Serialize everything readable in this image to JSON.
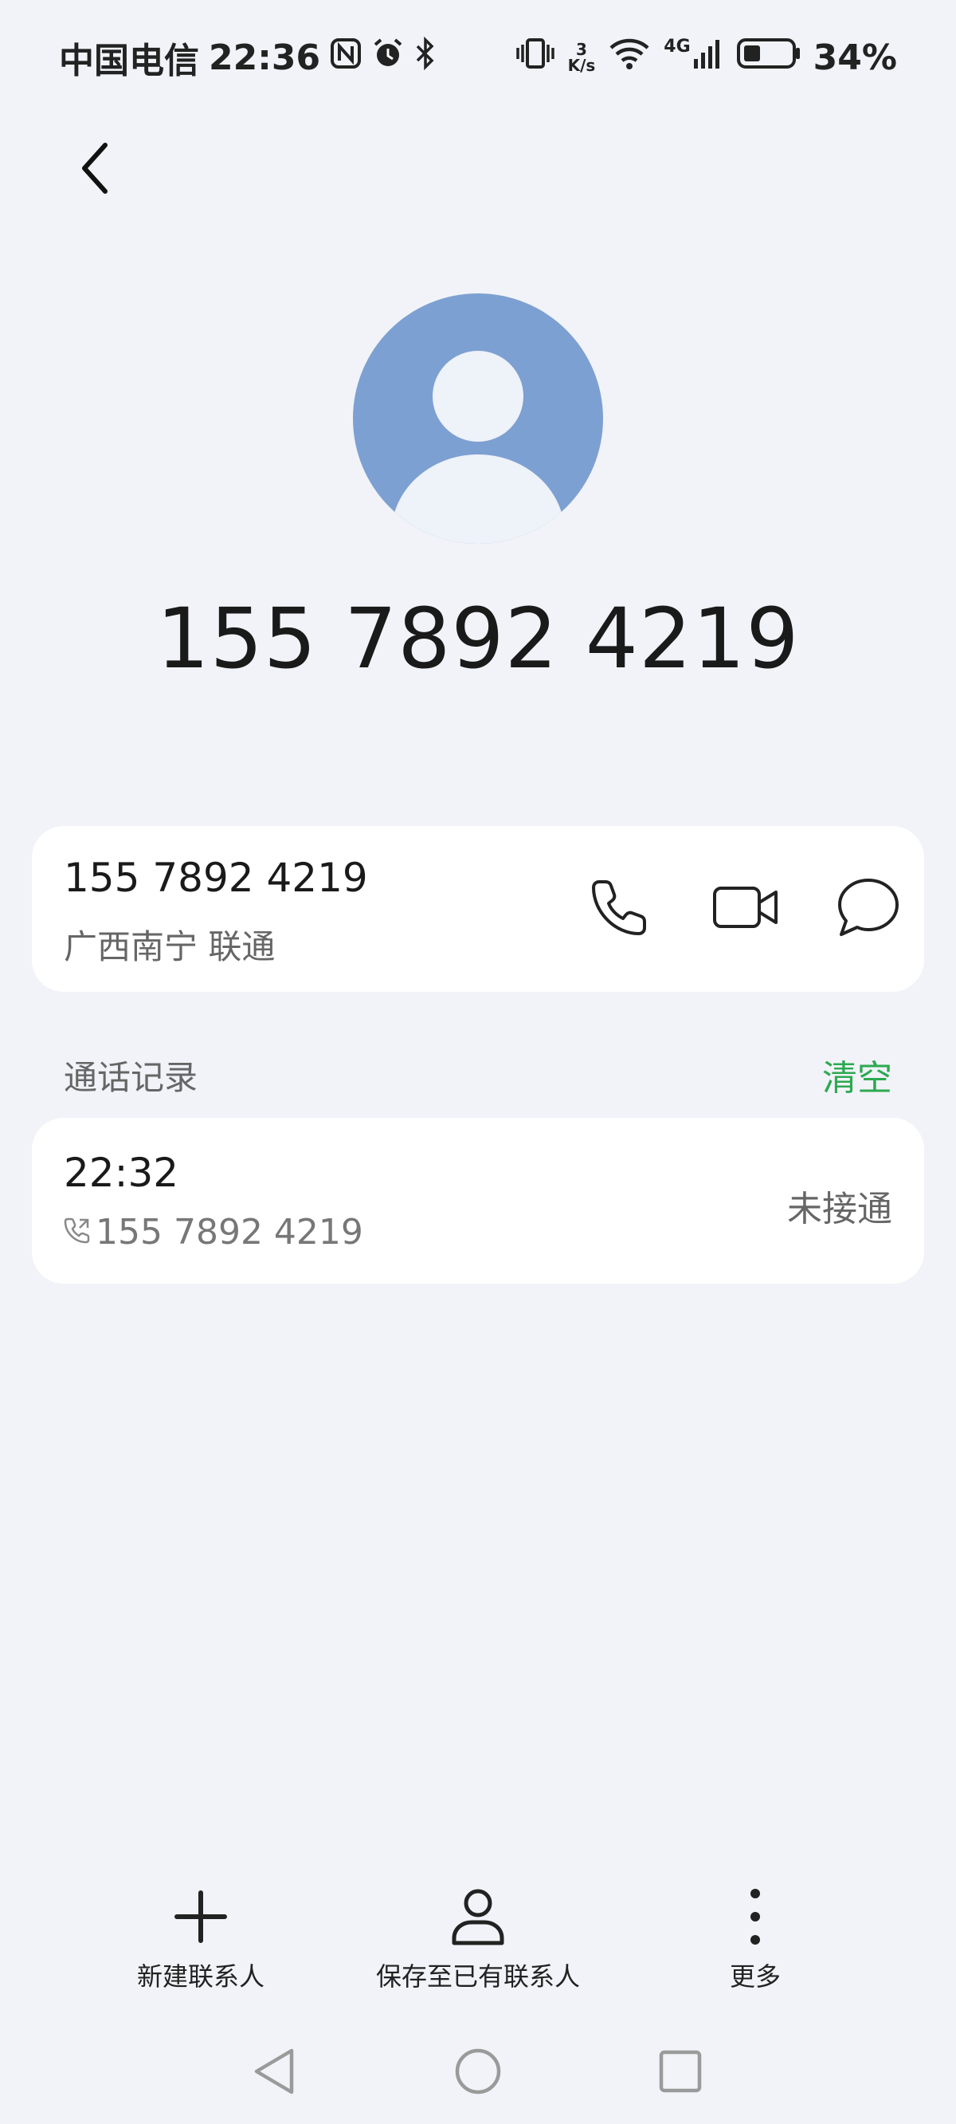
{
  "status_bar": {
    "carrier": "中国电信",
    "time": "22:36",
    "net_speed_value": "3",
    "net_speed_unit": "K/s",
    "network_type": "4G",
    "battery": "34%",
    "icons": [
      "nfc-icon",
      "alarm-icon",
      "bluetooth-icon",
      "vibrate-icon",
      "wifi-icon",
      "signal-icon",
      "battery-icon"
    ]
  },
  "contact": {
    "number": "155 7892 4219"
  },
  "number_card": {
    "number": "155 7892 4219",
    "location": "广西南宁 联通",
    "actions": [
      "phone-icon",
      "video-call-icon",
      "message-icon"
    ]
  },
  "call_log": {
    "title": "通话记录",
    "clear_label": "清空",
    "entries": [
      {
        "time": "22:32",
        "number": "155 7892 4219",
        "status": "未接通"
      }
    ]
  },
  "bottom_actions": {
    "new_contact": "新建联系人",
    "save_existing": "保存至已有联系人",
    "more": "更多"
  },
  "colors": {
    "background": "#F1F3F8",
    "avatar": "#7DA0D2",
    "accent_green": "#2DA94F",
    "card": "#FFFFFF"
  }
}
